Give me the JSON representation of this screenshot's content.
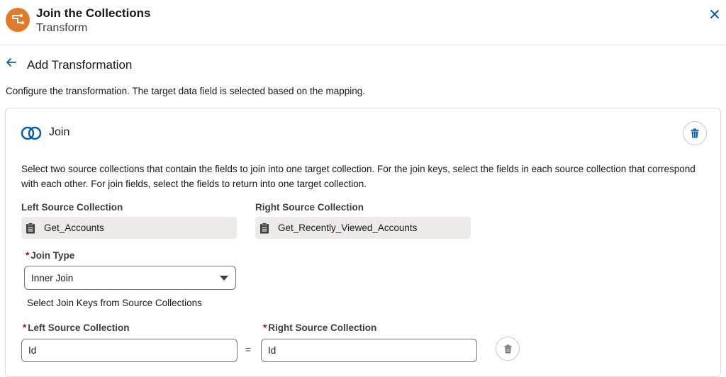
{
  "header": {
    "title": "Join the Collections",
    "subtitle": "Transform",
    "app_icon": "transform-icon",
    "close_icon": "close-icon",
    "app_icon_color": "#e07b2c"
  },
  "nav": {
    "back_icon": "arrow-left-icon",
    "title": "Add Transformation"
  },
  "description": "Configure the transformation. The target data field is selected based on the mapping.",
  "card": {
    "title": "Join",
    "icon": "join-circles-icon",
    "description": "Select two source collections that contain the fields to join into one target collection. For the join keys, select the fields in each source collection that correspond with each other. For join fields, select the fields to return into one target collection.",
    "left_source": {
      "label": "Left Source Collection",
      "value": "Get_Accounts"
    },
    "right_source": {
      "label": "Right Source Collection",
      "value": "Get_Recently_Viewed_Accounts"
    },
    "join_type": {
      "required_mark": "*",
      "label": "Join Type",
      "value": "Inner Join"
    },
    "join_keys_label": "Select Join Keys from Source Collections",
    "key_left": {
      "required_mark": "*",
      "label": "Left Source Collection",
      "value": "Id"
    },
    "key_right": {
      "required_mark": "*",
      "label": "Right Source Collection",
      "value": "Id"
    },
    "equals": "="
  },
  "colors": {
    "accent": "#0b5cab",
    "required": "#ba0517"
  }
}
